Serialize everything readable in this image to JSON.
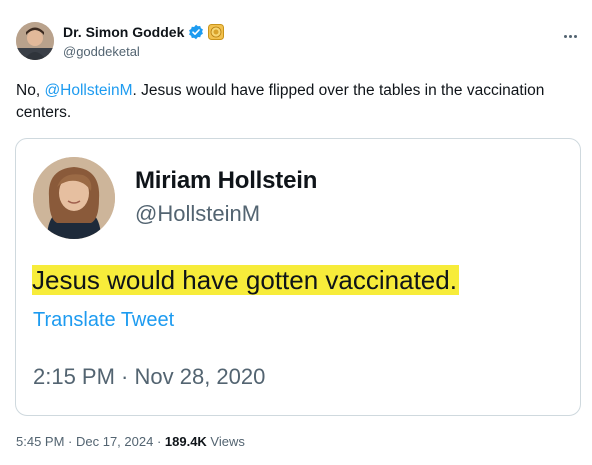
{
  "author": {
    "display_name": "Dr. Simon Goddek",
    "handle": "@goddeketal",
    "verified": true
  },
  "tweet": {
    "prefix": "No, ",
    "mention": "@HollsteinM",
    "suffix": ". Jesus would have flipped over the tables in the vaccination centers."
  },
  "quoted_tweet": {
    "display_name": "Miriam Hollstein",
    "handle": "@HollsteinM",
    "text": "Jesus would have gotten vaccinated.",
    "translate_label": "Translate Tweet",
    "datetime": "2:15 PM · Nov 28, 2020"
  },
  "meta": {
    "time": "5:45 PM",
    "separator1": " · ",
    "date": "Dec 17, 2024",
    "separator2": " · ",
    "views_count": "189.4K",
    "views_label": " Views"
  },
  "colors": {
    "link": "#1d9bf0",
    "verified": "#1d9bf0",
    "highlight": "#f7ec3a",
    "secondary_text": "#536471"
  },
  "icons": {
    "verified": "verified-badge-icon",
    "affiliate": "affiliate-badge-icon",
    "more": "more-icon"
  }
}
